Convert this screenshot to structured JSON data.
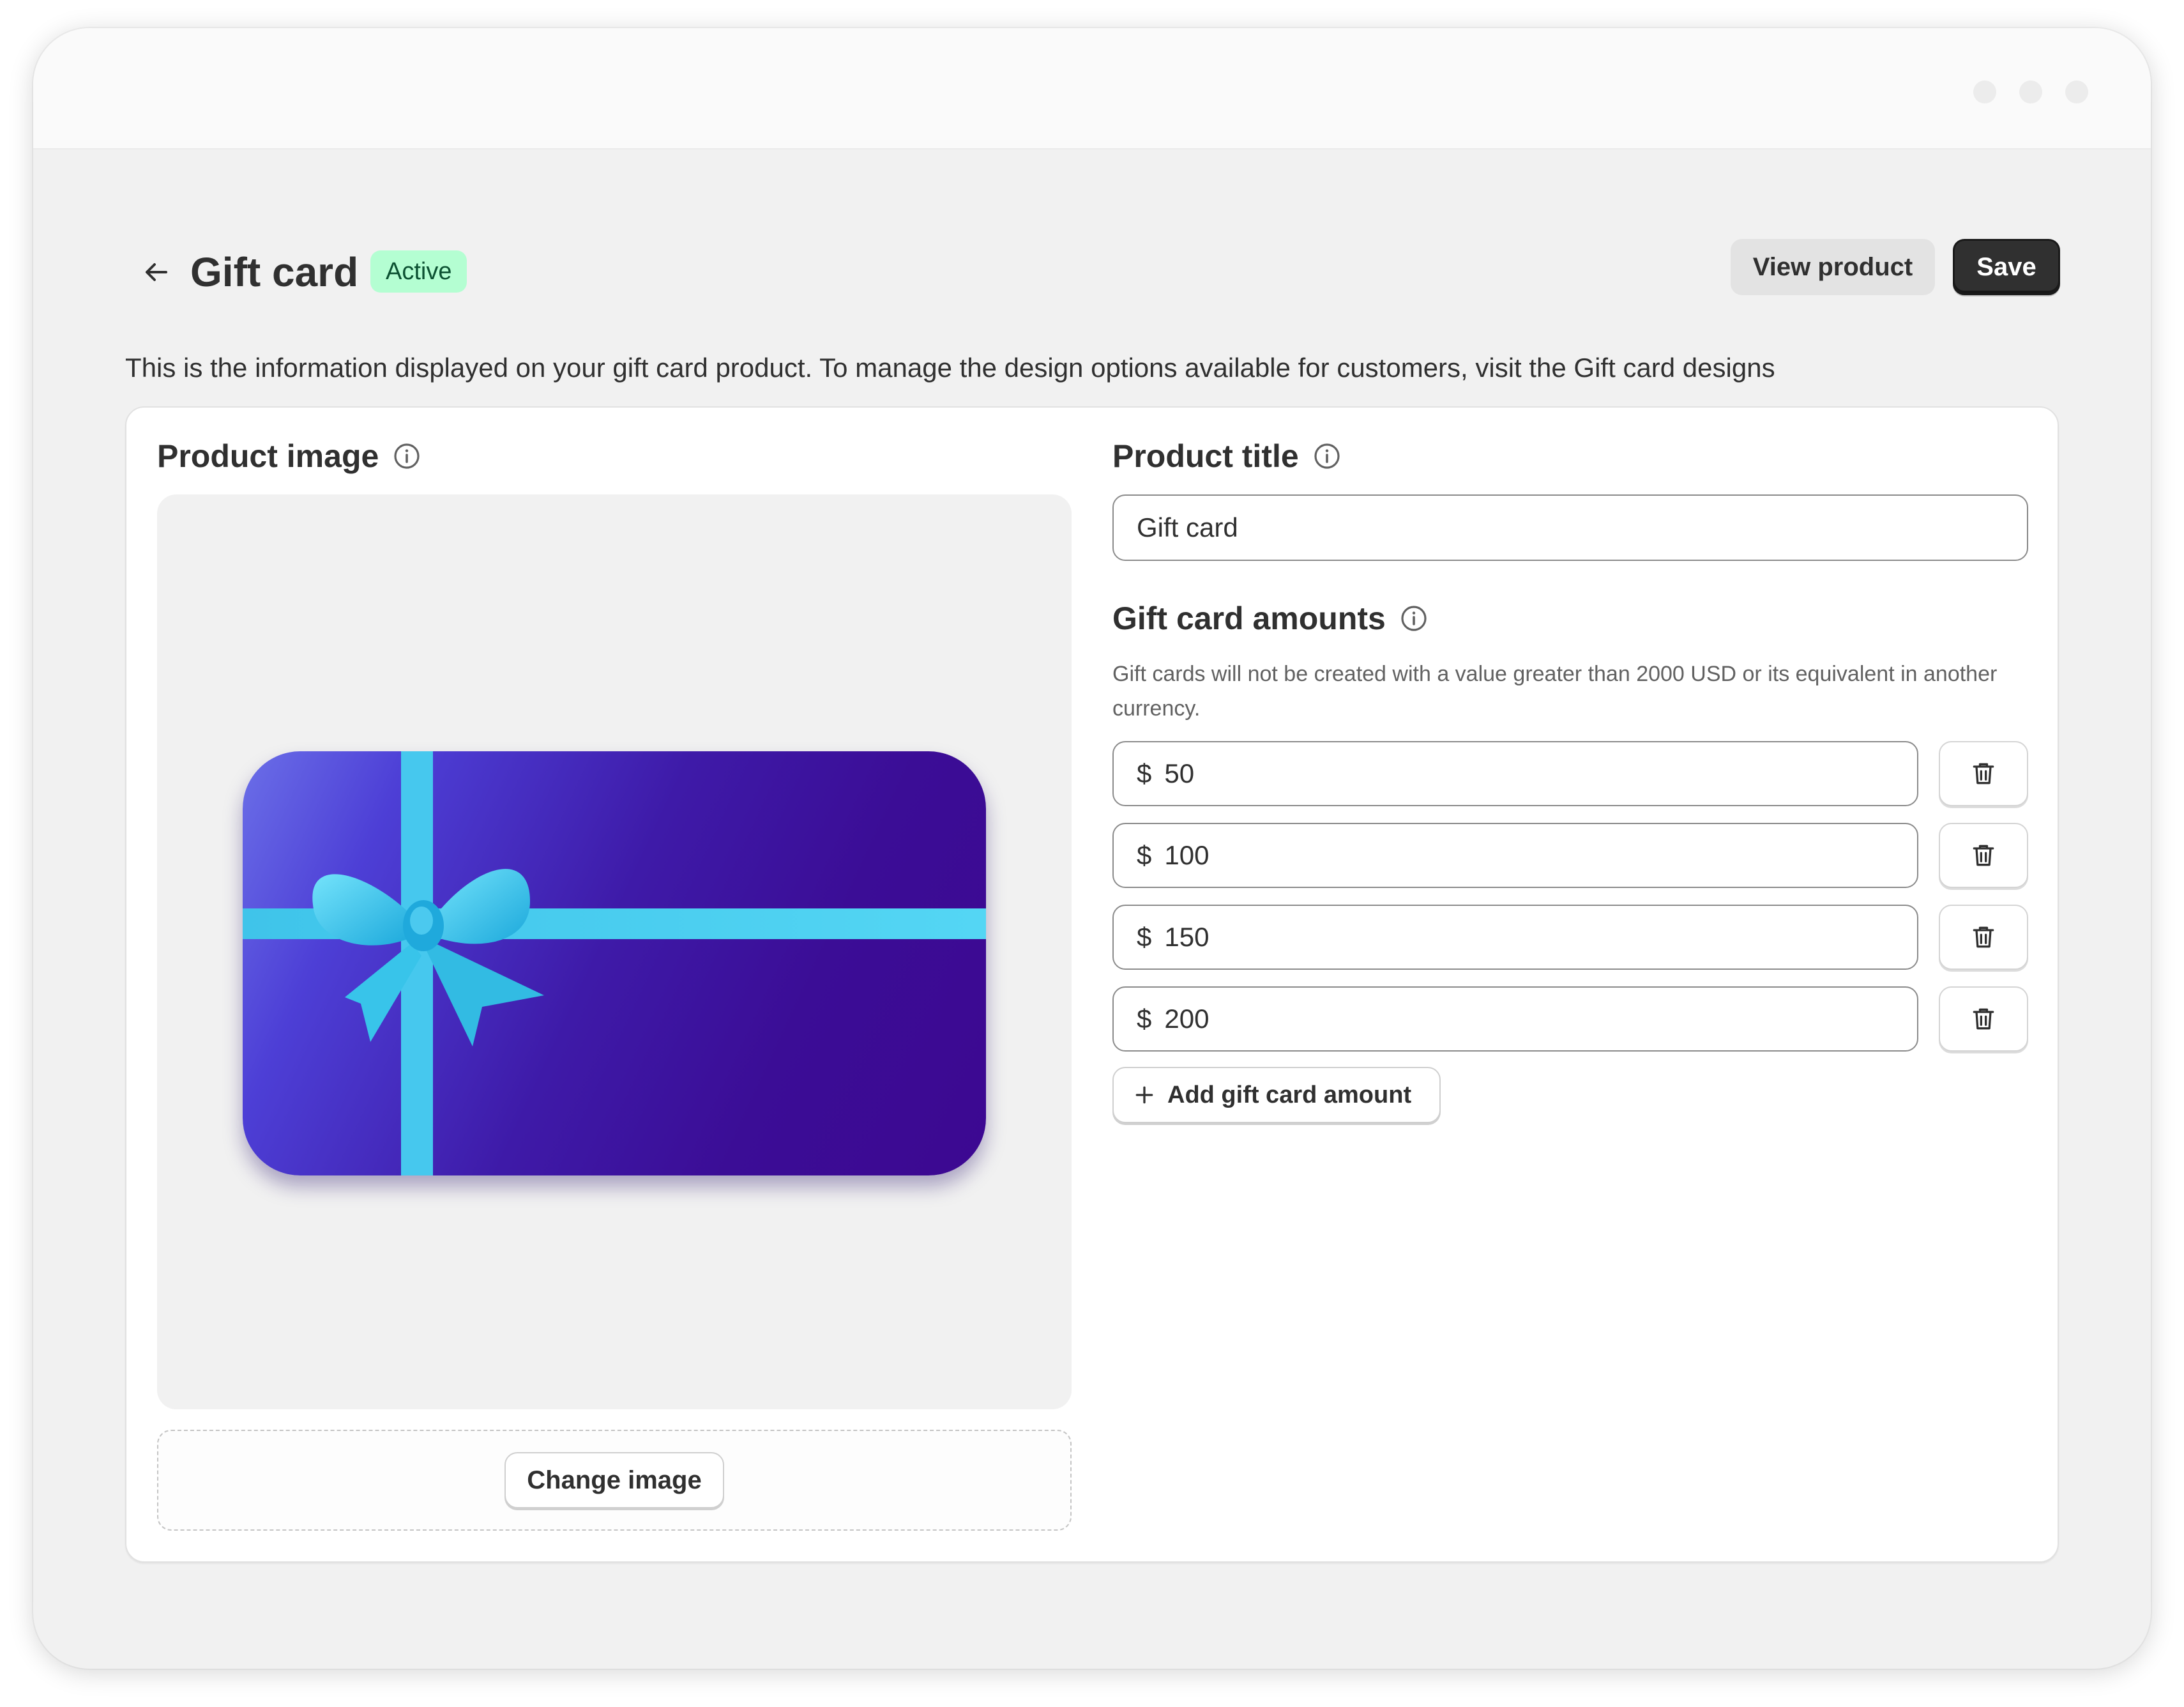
{
  "header": {
    "title": "Gift card",
    "status": "Active",
    "view_product_label": "View product",
    "save_label": "Save"
  },
  "description": "This is the information displayed on your gift card product. To manage the design options available for customers, visit the Gift card designs",
  "product_image": {
    "heading": "Product image",
    "change_button_label": "Change image"
  },
  "product_title": {
    "heading": "Product title",
    "value": "Gift card"
  },
  "amounts": {
    "heading": "Gift card amounts",
    "helper": "Gift cards will not be created with a value greater than 2000 USD or its equivalent in another currency.",
    "currency_symbol": "$",
    "items": [
      {
        "value": "50"
      },
      {
        "value": "100"
      },
      {
        "value": "150"
      },
      {
        "value": "200"
      }
    ],
    "add_button_label": "Add gift card amount"
  },
  "icons": {
    "back": "arrow-left-icon",
    "info": "info-icon",
    "delete": "trash-icon",
    "add": "plus-icon"
  },
  "colors": {
    "status_badge_bg": "#b4fed2",
    "status_badge_text": "#0c5132",
    "primary_button": "#303030",
    "ribbon": "#4fd4f2",
    "card_gradient_start": "#6b6fe8",
    "card_gradient_end": "#3c0891"
  }
}
